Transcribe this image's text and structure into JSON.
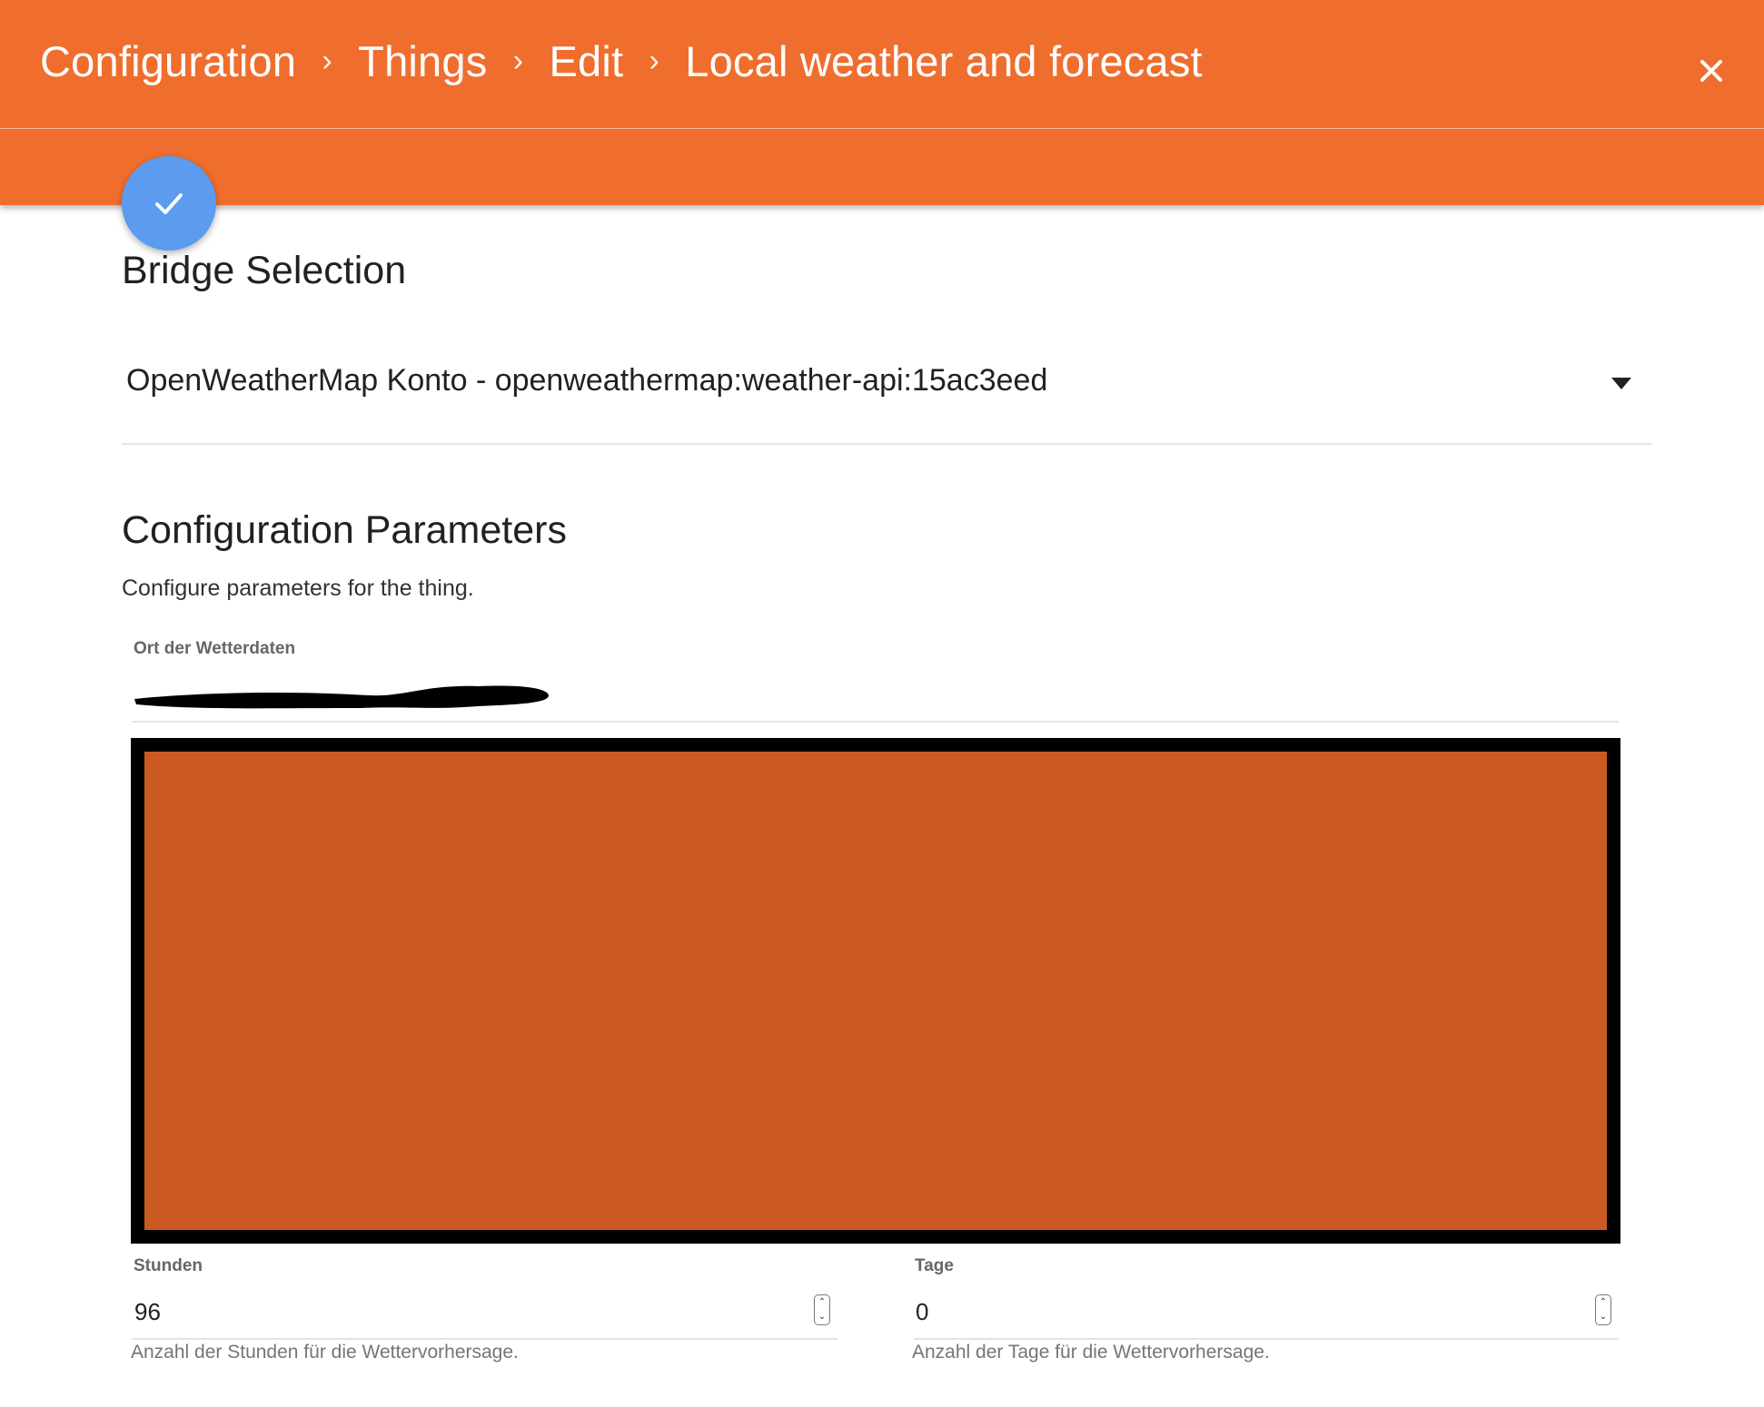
{
  "header": {
    "breadcrumbs": [
      "Configuration",
      "Things",
      "Edit",
      "Local weather and forecast"
    ],
    "close_icon": "close-icon",
    "background_color": "#ef6e2e"
  },
  "fab": {
    "icon": "check-icon",
    "color": "#5b9bf0"
  },
  "bridge_section": {
    "title": "Bridge Selection",
    "selected_value": "OpenWeatherMap Konto - openweathermap:weather-api:15ac3eed",
    "dropdown_icon": "dropdown-arrow-icon"
  },
  "config_section": {
    "title": "Configuration Parameters",
    "subtitle": "Configure parameters for the thing.",
    "location": {
      "label": "Ort der Wetterdaten"
    },
    "hours": {
      "label": "Stunden",
      "value": "96",
      "hint": "Anzahl der Stunden für die Wettervorhersage."
    },
    "days": {
      "label": "Tage",
      "value": "0",
      "hint": "Anzahl der Tage für die Wettervorhersage."
    }
  },
  "redaction_color": "#cb5a22"
}
